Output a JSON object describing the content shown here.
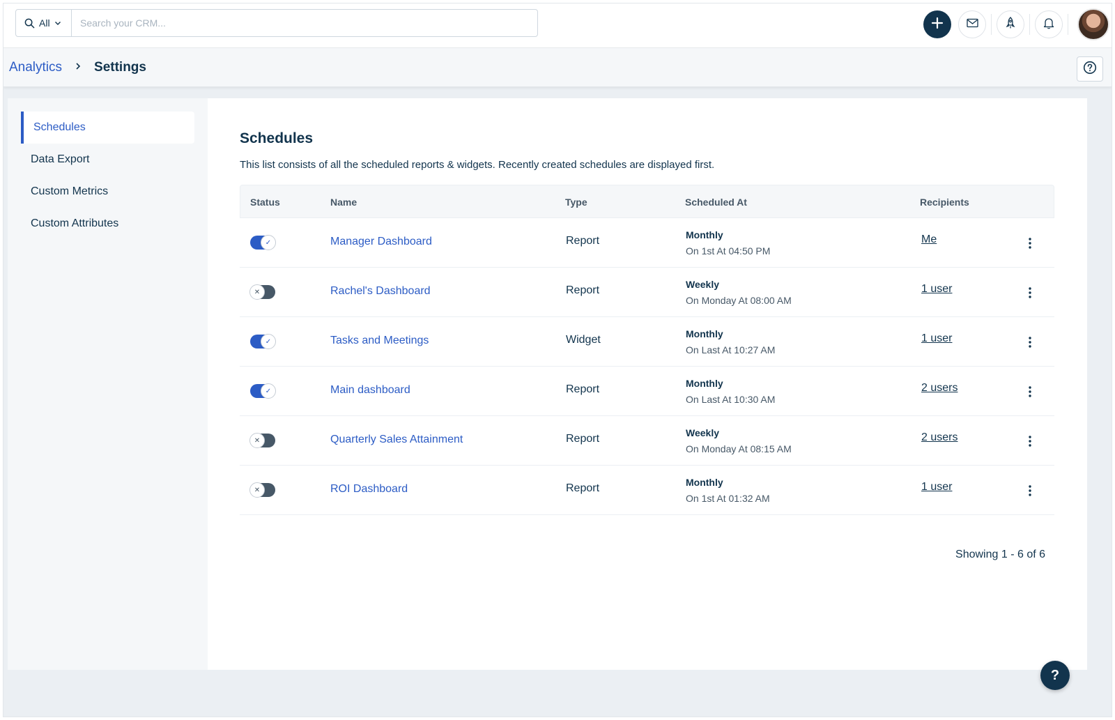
{
  "search": {
    "scope_label": "All",
    "placeholder": "Search your CRM..."
  },
  "breadcrumb": {
    "parent": "Analytics",
    "current": "Settings"
  },
  "sidebar": {
    "items": [
      {
        "label": "Schedules",
        "active": true
      },
      {
        "label": "Data Export",
        "active": false
      },
      {
        "label": "Custom Metrics",
        "active": false
      },
      {
        "label": "Custom Attributes",
        "active": false
      }
    ]
  },
  "main": {
    "title": "Schedules",
    "description": "This list consists of all the scheduled reports & widgets. Recently created schedules are displayed first.",
    "columns": {
      "status": "Status",
      "name": "Name",
      "type": "Type",
      "scheduled_at": "Scheduled At",
      "recipients": "Recipients"
    },
    "rows": [
      {
        "enabled": true,
        "name": "Manager Dashboard",
        "type": "Report",
        "frequency": "Monthly",
        "time": "On 1st At 04:50 PM",
        "recipients": "Me"
      },
      {
        "enabled": false,
        "name": "Rachel's Dashboard",
        "type": "Report",
        "frequency": "Weekly",
        "time": "On Monday At 08:00 AM",
        "recipients": "1 user"
      },
      {
        "enabled": true,
        "name": "Tasks and Meetings",
        "type": "Widget",
        "frequency": "Monthly",
        "time": "On Last At 10:27 AM",
        "recipients": "1 user"
      },
      {
        "enabled": true,
        "name": "Main dashboard",
        "type": "Report",
        "frequency": "Monthly",
        "time": "On Last At 10:30 AM",
        "recipients": "2 users"
      },
      {
        "enabled": false,
        "name": "Quarterly Sales Attainment",
        "type": "Report",
        "frequency": "Weekly",
        "time": "On Monday At 08:15 AM",
        "recipients": "2 users"
      },
      {
        "enabled": false,
        "name": "ROI Dashboard",
        "type": "Report",
        "frequency": "Monthly",
        "time": "On 1st At 01:32 AM",
        "recipients": "1 user"
      }
    ],
    "pagination": "Showing 1 - 6 of 6"
  },
  "floating_help": {
    "label": "?"
  },
  "colors": {
    "accent": "#2c5cc5",
    "primary_dark": "#12344d",
    "toggle_off": "#475867"
  }
}
